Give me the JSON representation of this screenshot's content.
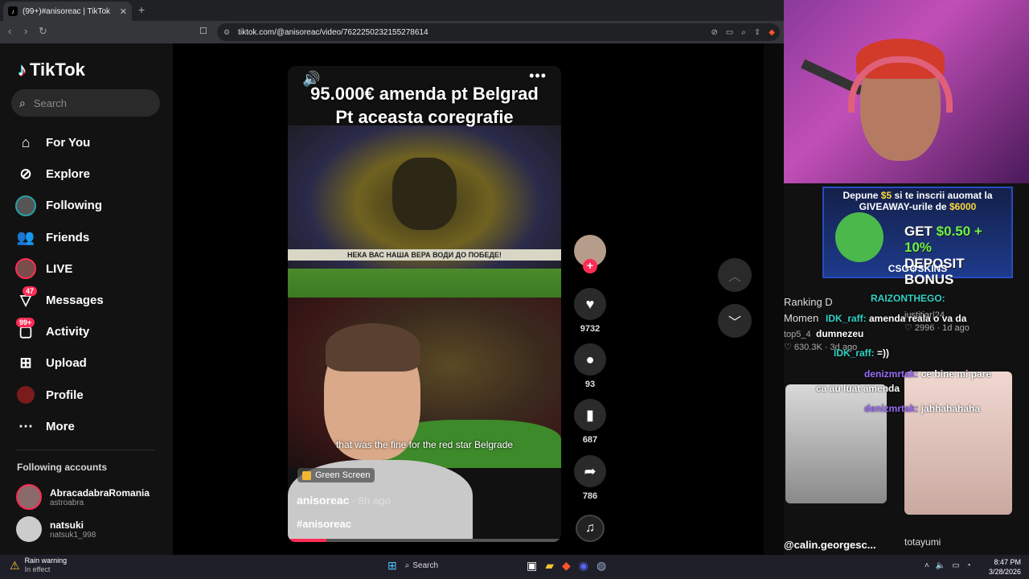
{
  "browser": {
    "tab_title": "(99+)#anisoreac | TikTok",
    "tab_close": "✕",
    "new_tab": "+",
    "url": "tiktok.com/@anisoreac/video/7622250232155278614"
  },
  "tiktok": {
    "logo_text": "TikTok",
    "search_placeholder": "Search",
    "nav": [
      {
        "label": "For You",
        "icon": "home-icon"
      },
      {
        "label": "Explore",
        "icon": "compass-icon"
      },
      {
        "label": "Following",
        "icon": "following-avatar-icon"
      },
      {
        "label": "Friends",
        "icon": "friends-icon"
      },
      {
        "label": "LIVE",
        "icon": "live-avatar-icon"
      },
      {
        "label": "Messages",
        "icon": "messages-icon",
        "badge": "47"
      },
      {
        "label": "Activity",
        "icon": "activity-icon",
        "badge": "99+"
      },
      {
        "label": "Upload",
        "icon": "upload-icon"
      },
      {
        "label": "Profile",
        "icon": "profile-avatar-icon"
      },
      {
        "label": "More",
        "icon": "more-icon"
      }
    ],
    "following_title": "Following accounts",
    "accounts": [
      {
        "name": "AbracadabraRomania",
        "handle": "astroabra"
      },
      {
        "name": "natsuki",
        "handle": "natsuk1_998"
      }
    ]
  },
  "video": {
    "title_line1": "95.000€ amenda pt Belgrad",
    "title_line2": "Pt aceasta coregrafie",
    "banner_text": "НЕКА ВАС НАША ВЕРА ВОДИ ДО ПОБЕДЕ!",
    "caption": "that was the fine for the red star Belgrade",
    "effect": "Green Screen",
    "author": "anisoreac",
    "posted": " · 8h ago",
    "hashtag": "#anisoreac",
    "progress": 0.14
  },
  "actions": {
    "likes": "9732",
    "comments": "93",
    "saves": "687",
    "shares": "786"
  },
  "stream": {
    "promo_line1a": "Depune ",
    "promo_line1b": "$5",
    "promo_line1c": " si te inscrii auomat la",
    "promo_line2a": "GIVEAWAY-urile de ",
    "promo_line2b": "$6000",
    "promo_big1a": "GET ",
    "promo_big1b": "$0.50 + 10%",
    "promo_big2": "DEPOSIT BONUS",
    "promo_brand": "CSG⚙SKINS",
    "chat": [
      {
        "user": "RAIZONTHEGO:",
        "msg": ""
      },
      {
        "user": "IDK_raff:",
        "msg": " amenda reala o va da"
      },
      {
        "user": "",
        "msg": "dumnezeu"
      },
      {
        "user": "IDK_raff:",
        "msg": " =))"
      },
      {
        "user": "denizmrtak:",
        "msg": " ce bine mi pare"
      },
      {
        "user": "",
        "msg": "ca au luat amenda"
      },
      {
        "user": "denizmrtak:",
        "msg": " jahhahahaha"
      }
    ],
    "rank_title1": "Ranking D",
    "rank_title2": "Momen",
    "rank_meta1": "top5_4",
    "rank_meta2": "♡ 630.3K · 3d ago",
    "side_meta1": "justitiar|24",
    "side_meta2": "♡ 2996 · 1d ago",
    "foot_left": "@calin.georgesc...",
    "foot_right": "totayumi"
  },
  "taskbar": {
    "weather_title": "Rain warning",
    "weather_sub": "In effect",
    "search": "Search",
    "time": "8:47 PM",
    "date": "3/28/2026"
  }
}
